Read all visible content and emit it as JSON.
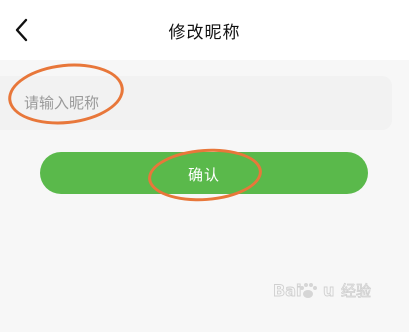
{
  "header": {
    "title": "修改昵称",
    "back_icon": "chevron-left-icon"
  },
  "nickname": {
    "placeholder": "请输入昵称",
    "value": ""
  },
  "confirm": {
    "label": "确认"
  },
  "watermark": {
    "text": "Baidu 经验",
    "logo_icon": "baidu-paw-icon"
  },
  "colors": {
    "accent_green": "#5ab94b",
    "annotation_orange": "#e8773a",
    "page_background": "#f7f7f7",
    "input_background": "#f2f2f2"
  }
}
